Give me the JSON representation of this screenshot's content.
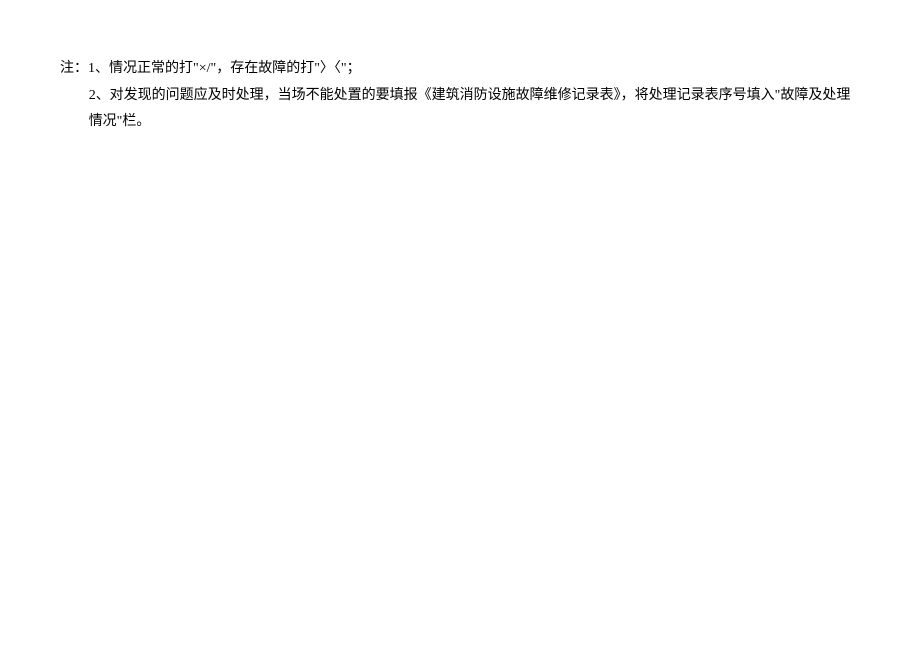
{
  "notes": {
    "label": "注：",
    "line1": "1、情况正常的打\"×/\"，存在故障的打\"〉〈\"；",
    "line2": "2、对发现的问题应及时处理，当场不能处置的要填报《建筑消防设施故障维修记录表》，将处理记录表序号填入\"故障及处理情况\"栏。"
  }
}
